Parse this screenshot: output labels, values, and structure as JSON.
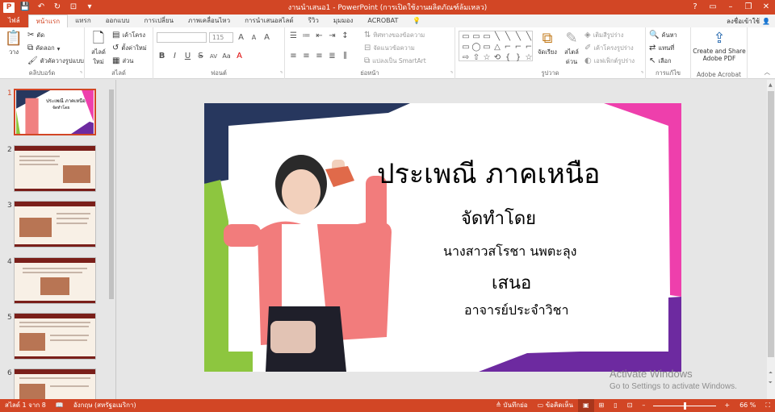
{
  "titlebar": {
    "app_logo": "P",
    "title": "งานนำเสนอ1 - PowerPoint (การเปิดใช้งานผลิตภัณฑ์ล้มเหลว)",
    "qat_icons": [
      "save-icon",
      "undo-icon",
      "redo-icon",
      "start-from-beginning-icon"
    ],
    "window_controls": [
      "?",
      "▭",
      "–",
      "❐",
      "✕"
    ]
  },
  "tabs": {
    "items": [
      "ไฟล์",
      "หน้าแรก",
      "แทรก",
      "ออกแบบ",
      "การเปลี่ยน",
      "ภาพเคลื่อนไหว",
      "การนำเสนอสไลด์",
      "รีวิว",
      "มุมมอง",
      "ACROBAT"
    ],
    "active_index": 1,
    "tell_me_icon": "lightbulb-icon",
    "signin": "ลงชื่อเข้าใช้",
    "share_icon": "share-icon"
  },
  "ribbon": {
    "clipboard": {
      "label": "คลิปบอร์ด",
      "paste": "วาง",
      "cut": "ตัด",
      "copy": "คัดลอก",
      "format_painter": "ตัวคัดวางรูปแบบ"
    },
    "slides": {
      "label": "สไลด์",
      "new_slide": "สไลด์ใหม่",
      "layout": "เค้าโครง",
      "reset": "ตั้งค่าใหม่",
      "section": "ส่วน"
    },
    "font": {
      "label": "ฟอนต์",
      "size_value": "115",
      "grow": "A",
      "shrink": "A",
      "clear": "A",
      "bold": "B",
      "italic": "I",
      "underline": "U",
      "strike": "S",
      "spacing": "AV",
      "case": "Aa",
      "color": "A"
    },
    "paragraph": {
      "label": "ย่อหน้า",
      "text_direction": "ทิศทางของข้อความ",
      "align_text": "จัดแนวข้อความ",
      "smartart": "แปลงเป็น SmartArt"
    },
    "drawing": {
      "label": "รูปวาด",
      "arrange": "จัดเรียง",
      "quick_styles": "สไตล์ด่วน",
      "fill": "เติมสีรูปร่าง",
      "outline": "เค้าโครงรูปร่าง",
      "effects": "เอฟเฟ็กต์รูปร่าง",
      "shapes": [
        "▭",
        "▭",
        "▭",
        "╲",
        "╲",
        "╲",
        "╲",
        "▭",
        "◯",
        "▭",
        "△",
        "⌐",
        "⌐",
        "⌐",
        "⇨",
        "⇧",
        "☆",
        "⟲",
        "{",
        "}",
        "☆"
      ]
    },
    "editing": {
      "label": "การแก้ไข",
      "find": "ค้นหา",
      "replace": "แทนที่",
      "select": "เลือก"
    },
    "acrobat": {
      "label": "Adobe Acrobat",
      "create_share_line1": "Create and Share",
      "create_share_line2": "Adobe PDF"
    }
  },
  "thumbnails": {
    "numbers": [
      "1",
      "2",
      "3",
      "4",
      "5",
      "6"
    ],
    "active_index": 0,
    "slide1_title": "ประเพณี ภาคเหนือ",
    "slide1_sub": "จัดทำโดย"
  },
  "slide": {
    "title": "ประเพณี  ภาคเหนือ",
    "made_by": "จัดทำโดย",
    "author": "นางสาวสโรชา    นพตะลุง",
    "present": "เสนอ",
    "teacher": "อาจารย์ประจำวิชา",
    "colors": {
      "navy": "#27375e",
      "green": "#8dc63f",
      "pink": "#ee3fac",
      "purple": "#6d2aa0"
    }
  },
  "watermark": {
    "line1": "Activate Windows",
    "line2": "Go to Settings to activate Windows."
  },
  "statusbar": {
    "slide_count": "สไลด์ 1 จาก 8",
    "language": "อังกฤษ (สหรัฐอเมริกา)",
    "notes": "บันทึกย่อ",
    "comments": "ข้อคิดเห็น",
    "zoom": "66 %",
    "zoom_fraction": 0.5
  }
}
